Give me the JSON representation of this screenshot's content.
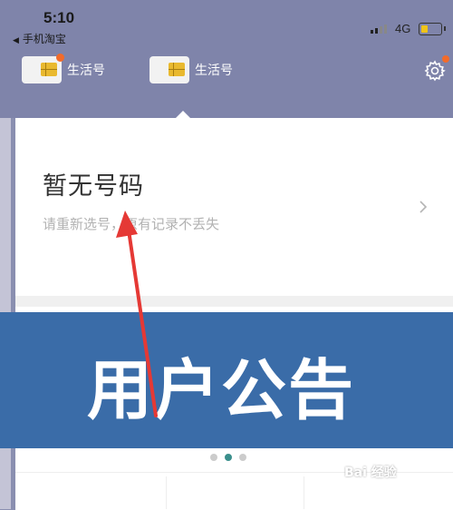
{
  "status_bar": {
    "time": "5:10",
    "back_app": "手机淘宝",
    "network": "4G"
  },
  "sim_tabs": [
    {
      "label": "生活号",
      "has_badge": true
    },
    {
      "label": "生活号",
      "has_badge": false
    }
  ],
  "card": {
    "title": "暂无号码",
    "hint": "请重新选号，原有记录不丢失"
  },
  "banner": {
    "text": "用户公告"
  },
  "carousel": {
    "count": 3,
    "active_index": 1
  },
  "watermark": {
    "text": "Bai 经验"
  },
  "colors": {
    "header": "#7f84aa",
    "banner": "#3a6ca8",
    "badge": "#f26b2a",
    "active_dot": "#3a8f8c",
    "arrow": "#e53935"
  }
}
